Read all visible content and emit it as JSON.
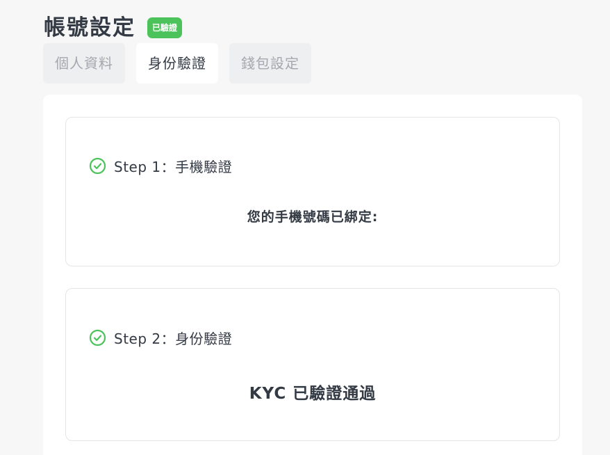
{
  "header": {
    "title": "帳號設定",
    "badge": "已驗證"
  },
  "tabs": [
    {
      "label": "個人資料",
      "active": false
    },
    {
      "label": "身份驗證",
      "active": true
    },
    {
      "label": "錢包設定",
      "active": false
    }
  ],
  "steps": [
    {
      "title": "Step 1：手機驗證",
      "message": "您的手機號碼已綁定:",
      "icon": "check-circle-icon",
      "completed": true
    },
    {
      "title": "Step 2：身份驗證",
      "message": "KYC 已驗證通過",
      "icon": "check-circle-icon",
      "completed": true
    }
  ],
  "colors": {
    "accent_green": "#4cc35a",
    "text_dark": "#333a44",
    "tab_inactive_text": "#a4a8ae",
    "tab_inactive_bg": "#eeeff1",
    "page_bg": "#f7f7f7"
  }
}
